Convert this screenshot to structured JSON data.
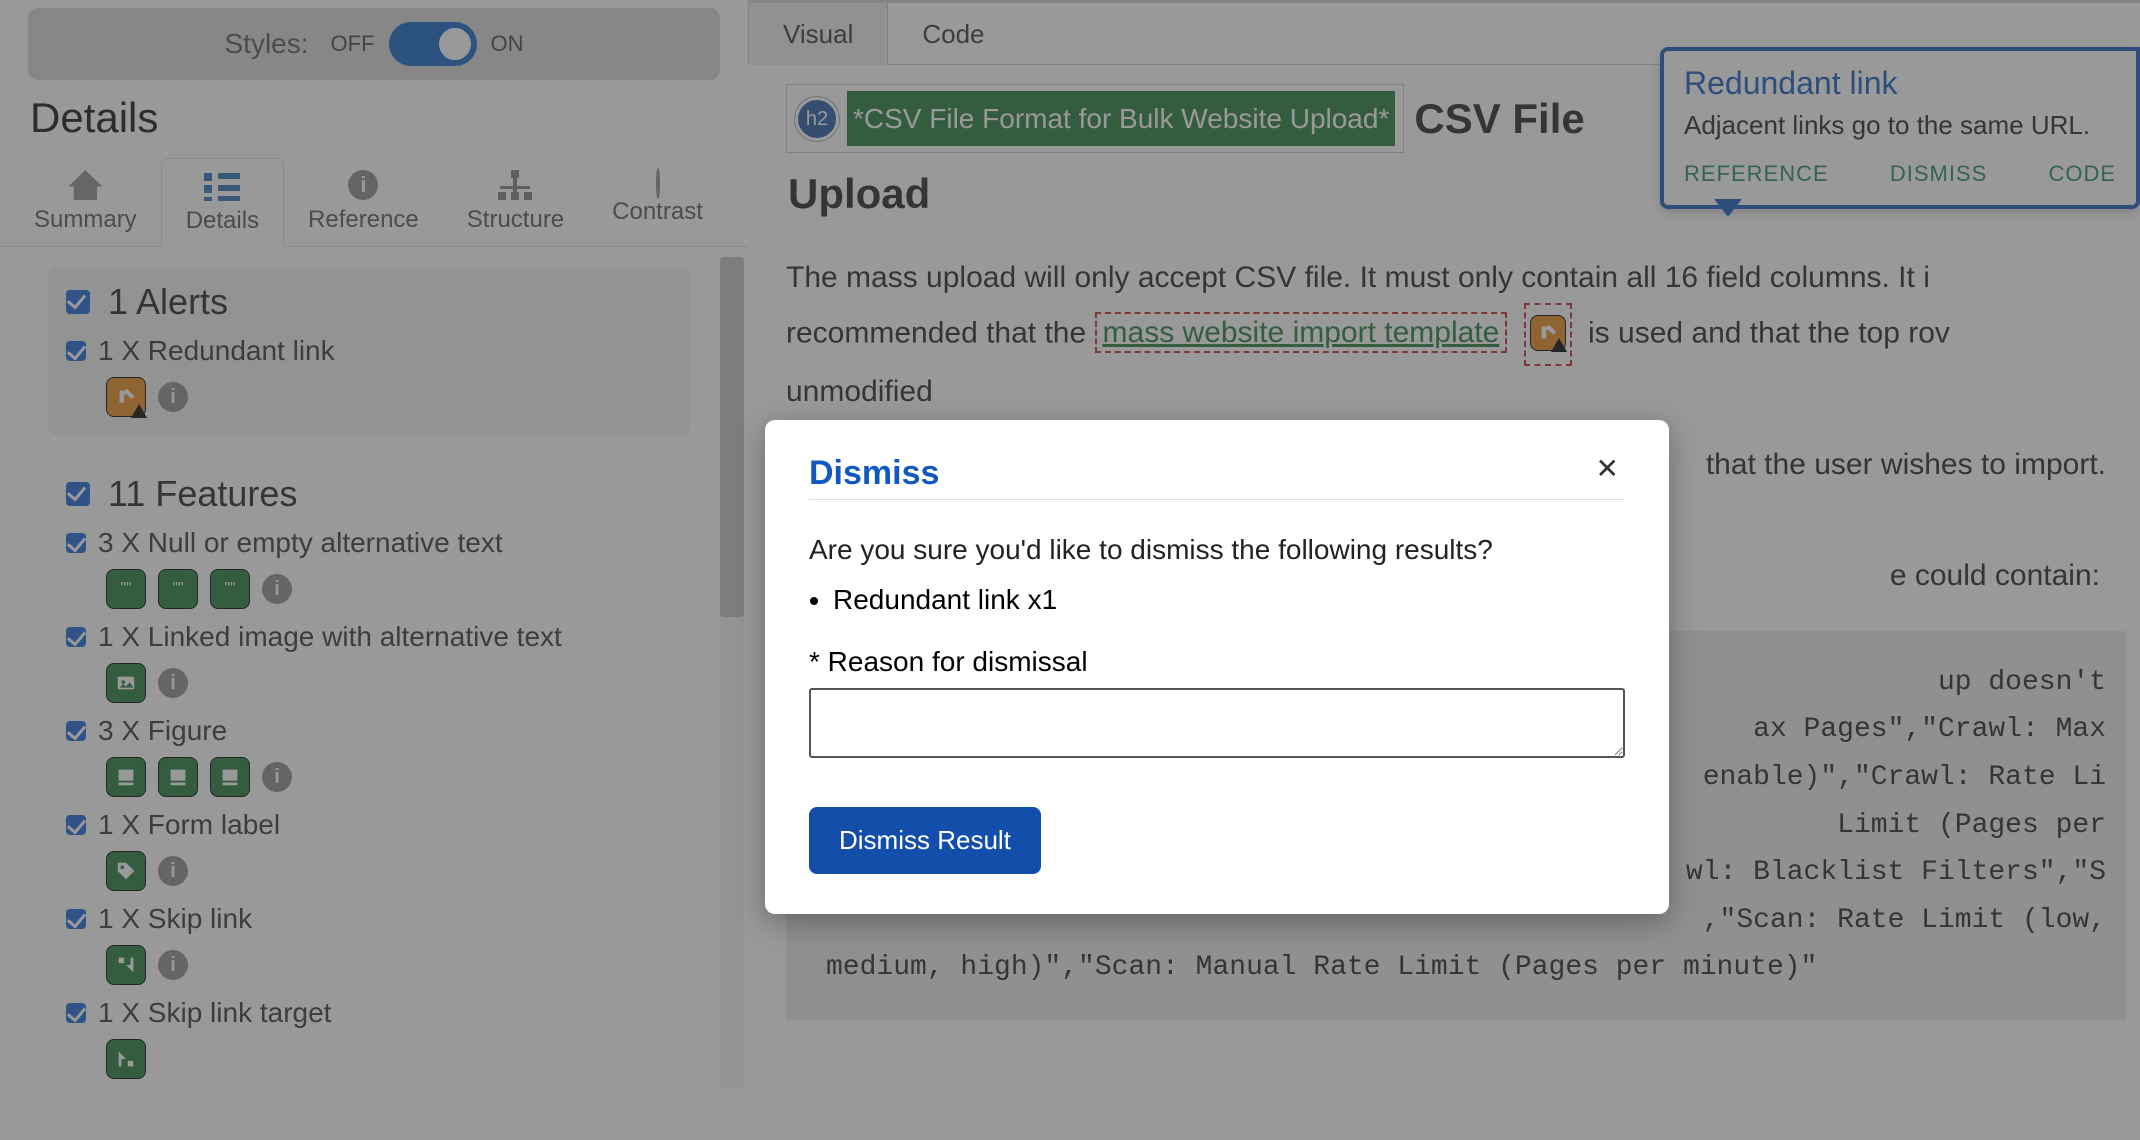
{
  "styles_row": {
    "label": "Styles:",
    "off": "OFF",
    "on": "ON",
    "state": "on"
  },
  "details_heading": "Details",
  "sidebar_tabs": {
    "summary": "Summary",
    "details": "Details",
    "reference": "Reference",
    "structure": "Structure",
    "contrast": "Contrast",
    "active": "details"
  },
  "groups": [
    {
      "title": "1 Alerts",
      "items": [
        {
          "label": "1 X Redundant link",
          "icons": [
            "redundant-link-icon"
          ],
          "info": true
        }
      ]
    },
    {
      "title": "11 Features",
      "items": [
        {
          "label": "3 X Null or empty alternative text",
          "icons": [
            "alt-icon",
            "alt-icon",
            "alt-icon"
          ],
          "info": true
        },
        {
          "label": "1 X Linked image with alternative text",
          "icons": [
            "linked-image-icon"
          ],
          "info": true
        },
        {
          "label": "3 X Figure",
          "icons": [
            "figure-icon",
            "figure-icon",
            "figure-icon"
          ],
          "info": true
        },
        {
          "label": "1 X Form label",
          "icons": [
            "tag-icon"
          ],
          "info": true
        },
        {
          "label": "1 X Skip link",
          "icons": [
            "skip-icon"
          ],
          "info": true
        },
        {
          "label": "1 X Skip link target",
          "icons": [
            "skip-target-icon"
          ],
          "info": false
        }
      ]
    }
  ],
  "content_tabs": {
    "visual": "Visual",
    "code": "Code",
    "active": "visual"
  },
  "h2_badge": "h2",
  "h2_highlight": "*CSV File Format for Bulk Website Upload*",
  "h2_line1": "CSV File",
  "h2_line2": "Upload",
  "para1a": "The mass upload will only accept CSV file. It must only contain all 16 field columns. It i",
  "para1b": "recommended that the ",
  "mass_link": "mass website import template",
  "para1c": " is used and that the top rov",
  "para1d": "unmodified",
  "para2_tail": "that the user wishes to import.",
  "para3_tail": "e could contain:",
  "code_lines": [
    "up doesn't",
    "ax Pages\",\"Crawl: Max",
    " enable)\",\"Crawl: Rate Li",
    " Limit (Pages per",
    "wl: Blacklist Filters\",\"S",
    ",\"Scan: Rate Limit (low,",
    "medium, high)\",\"Scan: Manual Rate Limit (Pages per minute)\""
  ],
  "popover": {
    "title": "Redundant link",
    "body": "Adjacent links go to the same URL.",
    "actions": {
      "reference": "REFERENCE",
      "dismiss": "DISMISS",
      "code": "CODE"
    }
  },
  "modal": {
    "title": "Dismiss",
    "question": "Are you sure you'd like to dismiss the following results?",
    "items": [
      "Redundant link x1"
    ],
    "reason_label": "* Reason for dismissal",
    "reason_value": "",
    "button": "Dismiss Result"
  }
}
